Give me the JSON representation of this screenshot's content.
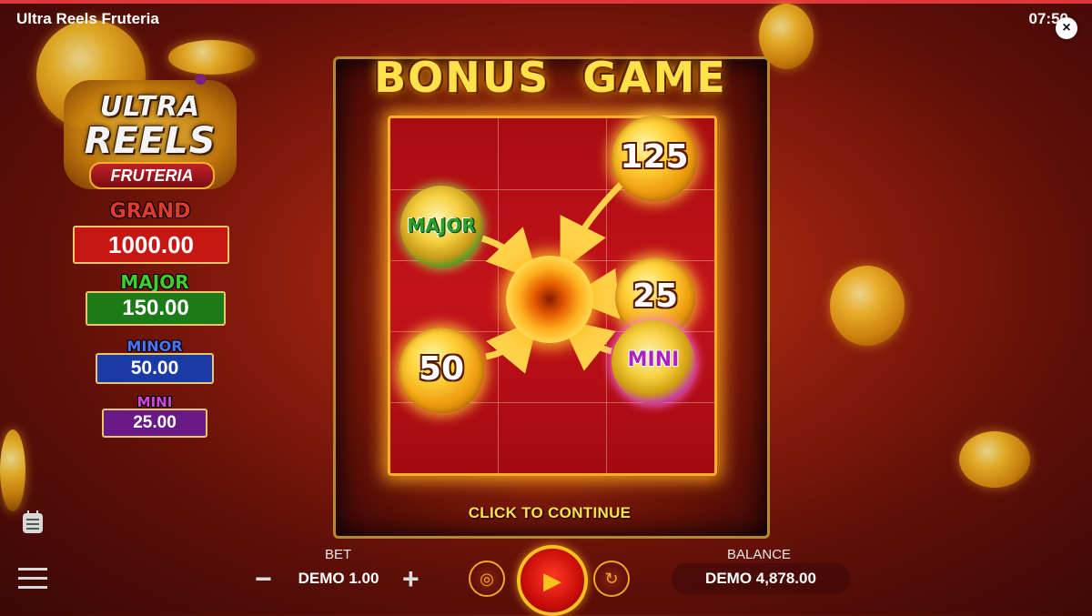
{
  "window": {
    "title": "Ultra Reels Fruteria",
    "clock": "07:50",
    "close_glyph": "×"
  },
  "logo": {
    "line1": "ULTRA",
    "line2": "REELS",
    "sub": "FRUTERIA"
  },
  "jackpots": [
    {
      "name": "GRAND",
      "value": "1000.00",
      "color": "#e23a2a",
      "box": "#c81612"
    },
    {
      "name": "MAJOR",
      "value": "150.00",
      "color": "#3ecf2f",
      "box": "#1c7a18"
    },
    {
      "name": "MINOR",
      "value": "50.00",
      "color": "#4c73ff",
      "box": "#1a3aa6"
    },
    {
      "name": "MINI",
      "value": "25.00",
      "color": "#d245e2",
      "box": "#6a1a86"
    }
  ],
  "bonus": {
    "title": "BONUS  GAME",
    "coins": [
      {
        "id": "coin-125",
        "label": "125",
        "kind": "value"
      },
      {
        "id": "coin-major",
        "label": "MAJOR",
        "kind": "jackpot"
      },
      {
        "id": "coin-25",
        "label": "25",
        "kind": "value"
      },
      {
        "id": "coin-50",
        "label": "50",
        "kind": "value"
      },
      {
        "id": "coin-mini",
        "label": "MINI",
        "kind": "jackpot"
      }
    ],
    "continue_label": "CLICK TO CONTINUE"
  },
  "bottom": {
    "bet_label": "BET",
    "bet_value": "DEMO 1.00",
    "balance_label": "BALANCE",
    "balance_value": "DEMO 4,878.00",
    "minus": "−",
    "plus": "+"
  },
  "icons": [
    "close-icon",
    "history-icon",
    "menu-icon",
    "coins-icon",
    "play-icon",
    "autoplay-icon"
  ]
}
